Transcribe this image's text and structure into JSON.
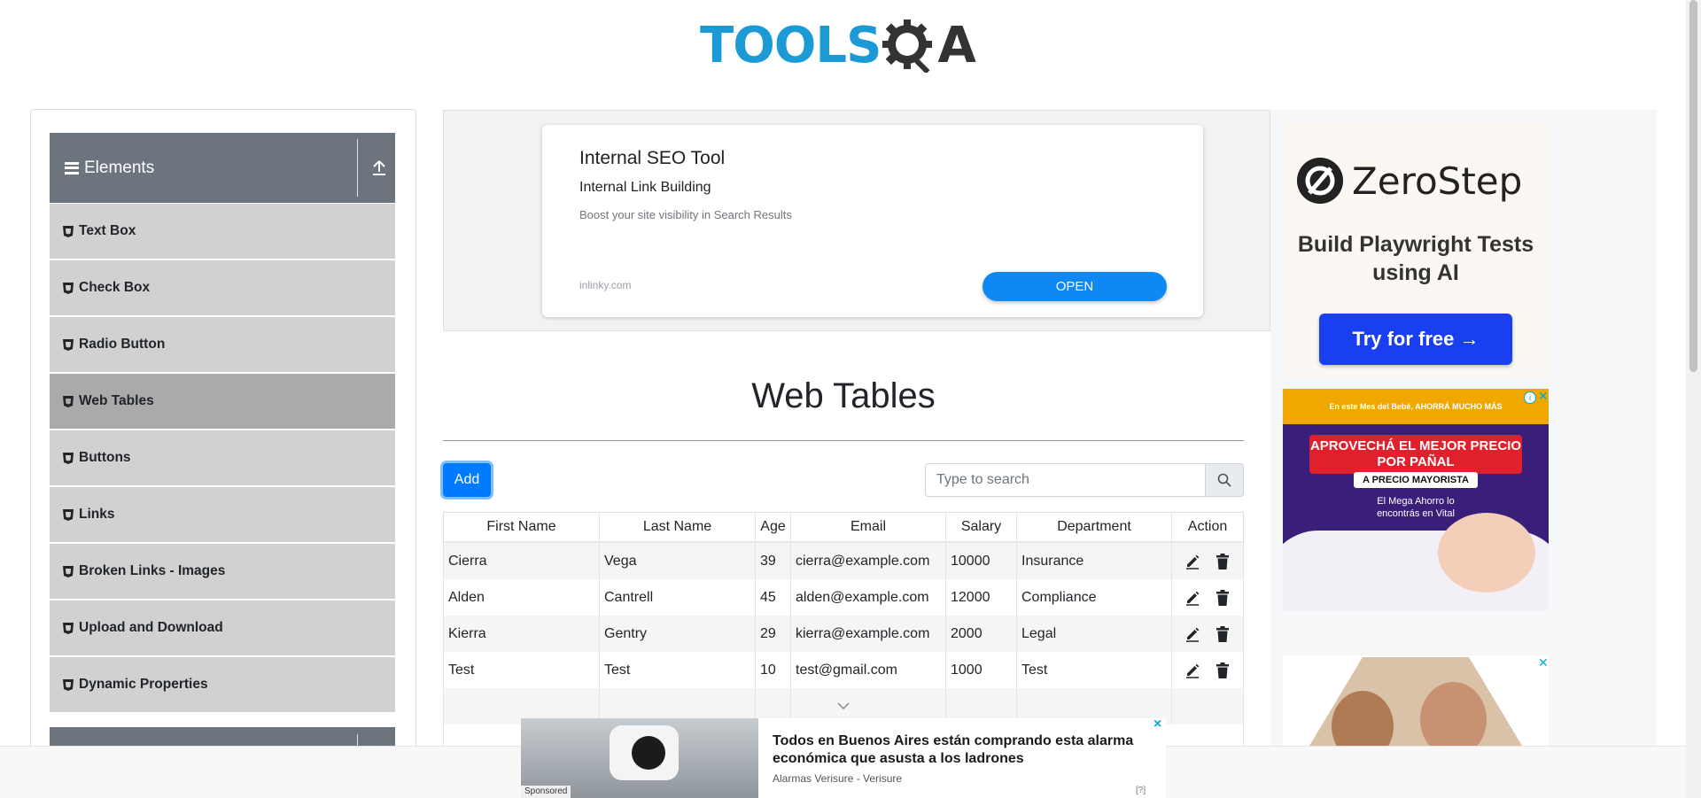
{
  "logo": {
    "text": "TOOLS",
    "suffix": "A"
  },
  "sidebar": {
    "group_title": "Elements",
    "items": [
      {
        "label": "Text Box"
      },
      {
        "label": "Check Box"
      },
      {
        "label": "Radio Button"
      },
      {
        "label": "Web Tables",
        "active": true
      },
      {
        "label": "Buttons"
      },
      {
        "label": "Links"
      },
      {
        "label": "Broken Links - Images"
      },
      {
        "label": "Upload and Download"
      },
      {
        "label": "Dynamic Properties"
      }
    ]
  },
  "top_ad": {
    "title": "Internal SEO Tool",
    "subtitle": "Internal Link Building",
    "description": "Boost your site visibility in Search Results",
    "domain": "inlinky.com",
    "button": "OPEN"
  },
  "main": {
    "title": "Web Tables",
    "add_button": "Add",
    "search_placeholder": "Type to search"
  },
  "table": {
    "headers": [
      "First Name",
      "Last Name",
      "Age",
      "Email",
      "Salary",
      "Department",
      "Action"
    ],
    "rows": [
      {
        "first": "Cierra",
        "last": "Vega",
        "age": "39",
        "email": "cierra@example.com",
        "salary": "10000",
        "department": "Insurance"
      },
      {
        "first": "Alden",
        "last": "Cantrell",
        "age": "45",
        "email": "alden@example.com",
        "salary": "12000",
        "department": "Compliance"
      },
      {
        "first": "Kierra",
        "last": "Gentry",
        "age": "29",
        "email": "kierra@example.com",
        "salary": "2000",
        "department": "Legal"
      },
      {
        "first": "Test",
        "last": "Test",
        "age": "10",
        "email": "test@gmail.com",
        "salary": "1000",
        "department": "Test"
      }
    ]
  },
  "right_ad": {
    "brand": "ZeroStep",
    "headline": "Build Playwright Tests using AI",
    "button": "Try for free →"
  },
  "vital_ad": {
    "top": "En este Mes del Bebé, AHORRÁ MUCHO MÁS",
    "banner": "APROVECHÁ EL MEJOR PRECIO POR PAÑAL",
    "sub": "A PRECIO MAYORISTA",
    "small": "El Mega Ahorro lo encontrás en Vital"
  },
  "bottom_ad": {
    "sponsored": "Sponsored",
    "title": "Todos en Buenos Aires están comprando esta alarma económica que asusta a los ladrones",
    "source": "Alarmas Verisure - Verisure",
    "meta": "[?]",
    "close": "×"
  },
  "colors": {
    "brand_blue": "#1c9ad6",
    "primary": "#007bff",
    "sidebar_header": "#6c757d",
    "menu_item": "#d1d1d1",
    "menu_active": "#aaaaaa"
  }
}
